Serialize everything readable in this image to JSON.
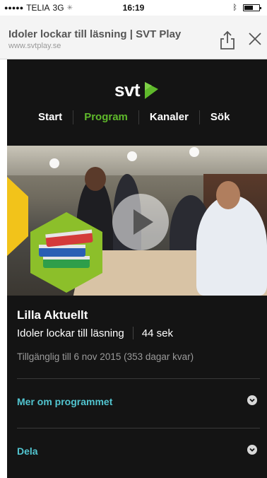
{
  "status_bar": {
    "signal": "●●●●●",
    "carrier": "TELIA",
    "network": "3G",
    "time": "16:19"
  },
  "browser": {
    "page_title": "Idoler lockar till läsning | SVT Play",
    "url": "www.svtplay.se",
    "share_icon": "share-icon",
    "close_icon": "close-icon"
  },
  "app": {
    "logo": "svt",
    "logo_badge": "play",
    "nav": [
      {
        "label": "Start",
        "active": false
      },
      {
        "label": "Program",
        "active": true
      },
      {
        "label": "Kanaler",
        "active": false
      },
      {
        "label": "Sök",
        "active": false
      }
    ],
    "accent_color": "#5fb92b",
    "link_color": "#52c5d0",
    "video": {
      "play_icon": "play-icon",
      "badge_icon": "books-icon"
    },
    "program_title": "Lilla Aktuellt",
    "episode_title": "Idoler lockar till läsning",
    "duration": "44 sek",
    "availability": "Tillgänglig till 6 nov 2015 (353 dagar kvar)",
    "sections": [
      {
        "label": "Mer om programmet"
      },
      {
        "label": "Dela"
      }
    ]
  }
}
